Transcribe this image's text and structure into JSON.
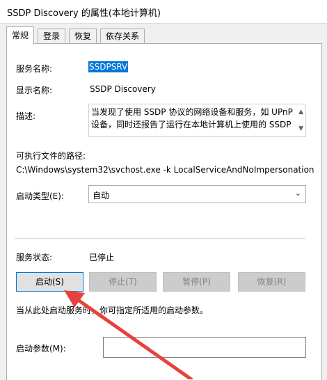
{
  "window": {
    "title": "SSDP Discovery 的属性(本地计算机)"
  },
  "tabs": [
    {
      "label": "常规",
      "active": true
    },
    {
      "label": "登录"
    },
    {
      "label": "恢复"
    },
    {
      "label": "依存关系"
    }
  ],
  "general": {
    "service_name_label": "服务名称:",
    "service_name_value": "SSDPSRV",
    "display_name_label": "显示名称:",
    "display_name_value": "SSDP Discovery",
    "description_label": "描述:",
    "description_text": "当发现了使用 SSDP 协议的网络设备和服务，如 UPnP 设备，同时还报告了运行在本地计算机上使用的 SSDP",
    "exe_path_label": "可执行文件的路径:",
    "exe_path_value": "C:\\Windows\\system32\\svchost.exe -k LocalServiceAndNoImpersonation",
    "startup_type_label": "启动类型(E):",
    "startup_type_value": "自动",
    "status_label": "服务状态:",
    "status_value": "已停止",
    "hint": "当从此处启动服务时，你可指定所适用的启动参数。",
    "start_params_label": "启动参数(M):"
  },
  "buttons": {
    "start": "启动(S)",
    "stop": "停止(T)",
    "pause": "暂停(P)",
    "resume": "恢复(R)"
  },
  "colors": {
    "selection": "#0078d7",
    "annotation_arrow": "#e8413c"
  }
}
